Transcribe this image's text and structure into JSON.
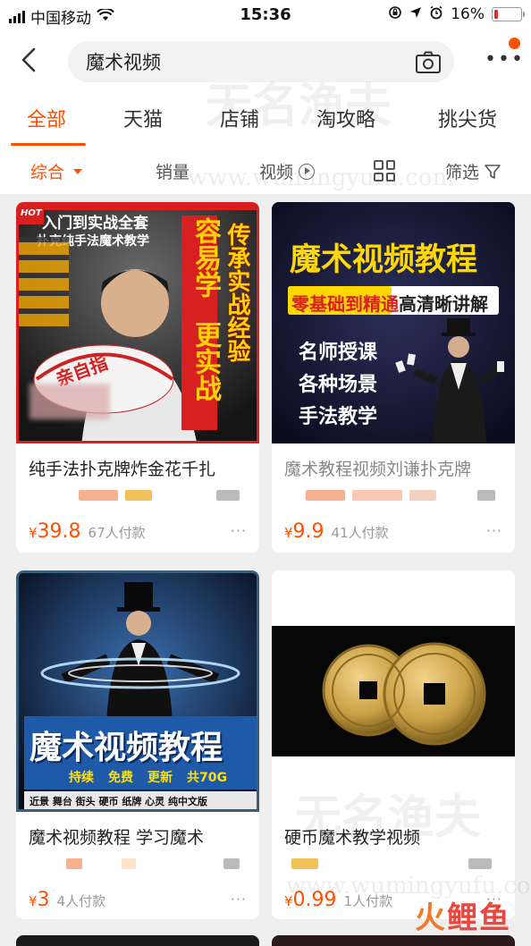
{
  "status_bar": {
    "carrier": "中国移动",
    "time": "15:36",
    "battery": "16%",
    "battery_level": 0.16
  },
  "search": {
    "query": "魔术视频"
  },
  "tabs": [
    {
      "label": "全部",
      "active": true
    },
    {
      "label": "天猫"
    },
    {
      "label": "店铺"
    },
    {
      "label": "淘攻略"
    },
    {
      "label": "挑尖货"
    }
  ],
  "sort": {
    "composite": "综合",
    "sales": "销量",
    "video": "视频",
    "filter": "筛选"
  },
  "products": [
    {
      "title": "纯手法扑克牌炸金花千扎",
      "price_symbol": "¥",
      "price": "39.8",
      "sold": "67人付款",
      "more": "···",
      "image": {
        "banner": "入门到实战全套",
        "subtitle": "扑克纯手法魔术教学",
        "hot": "HOT",
        "slogan1": "容易学",
        "slogan2": "更实战",
        "slogan3": "传承实战经验",
        "cards_label": "亲自指"
      }
    },
    {
      "title": "魔术教程视频刘谦扑克牌",
      "price_symbol": "¥",
      "price": "9.9",
      "sold": "41人付款",
      "more": "···",
      "image": {
        "headline": "魔术视频教程",
        "sub_yellow": "零基础到精通",
        "sub_white": "高清晰讲解",
        "line1": "名师授课",
        "line2": "各种场景",
        "line3": "手法教学"
      }
    },
    {
      "title": "魔术视频教程 学习魔术",
      "price_symbol": "¥",
      "price": "3",
      "sold": "4人付款",
      "more": "···",
      "image": {
        "headline": "魔术视频教程",
        "tag1": "持续",
        "tag2": "免费",
        "tag3": "更新",
        "tag4": "共70G",
        "footer": "近景 舞台 街头 硬币 纸牌 心灵 纯中文版"
      }
    },
    {
      "title": "硬币魔术教学视频",
      "price_symbol": "¥",
      "price": "0.99",
      "sold": "1人付款",
      "more": "···",
      "image": {}
    }
  ],
  "watermark": {
    "cn": "无名渔夫",
    "url": "www.wumingyufu.com",
    "brand": "鲤鱼"
  },
  "colors": {
    "accent": "#ff5000",
    "price": "#ff5000"
  }
}
